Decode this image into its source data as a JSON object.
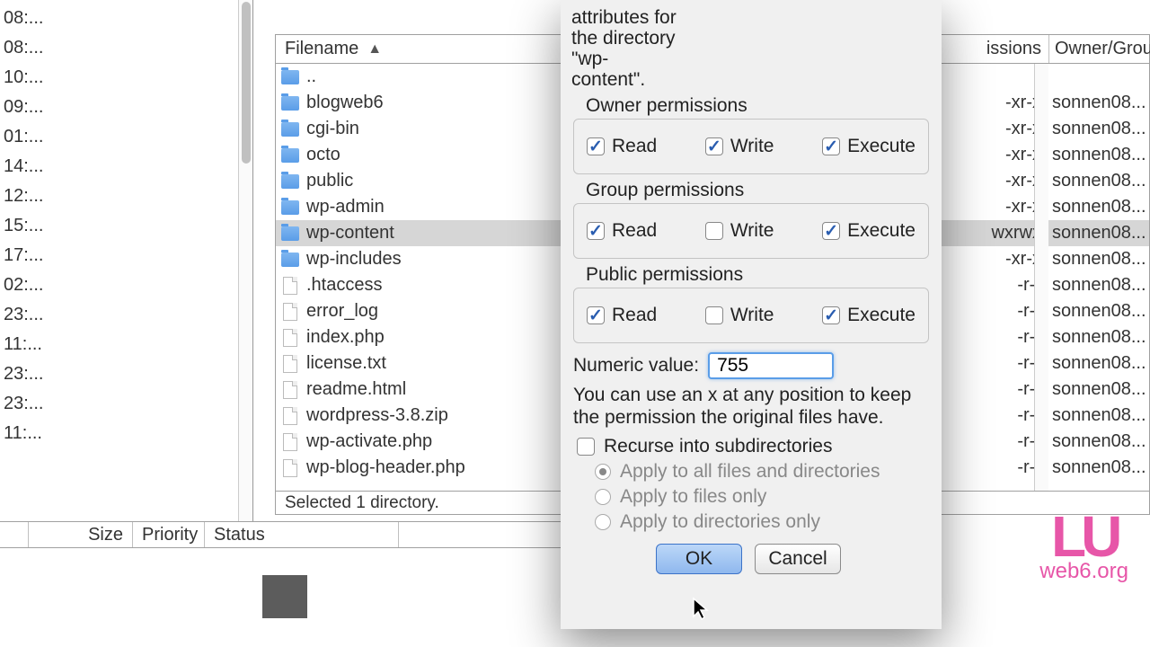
{
  "left_rows": [
    "08:...",
    "08:...",
    "10:...",
    "09:...",
    "01:...",
    "14:...",
    "12:...",
    "15:...",
    "17:...",
    "02:...",
    "23:...",
    "11:...",
    "23:...",
    "23:...",
    "11:..."
  ],
  "right_header": {
    "filename": "Filename",
    "permissions": "issions",
    "owner": "Owner/Group"
  },
  "files": [
    {
      "name": "..",
      "type": "folder",
      "perm": "",
      "owner": ""
    },
    {
      "name": "blogweb6",
      "type": "folder",
      "perm": "-xr-x",
      "owner": "sonnen08..."
    },
    {
      "name": "cgi-bin",
      "type": "folder",
      "perm": "-xr-x",
      "owner": "sonnen08..."
    },
    {
      "name": "octo",
      "type": "folder",
      "perm": "-xr-x",
      "owner": "sonnen08..."
    },
    {
      "name": "public",
      "type": "folder",
      "perm": "-xr-x",
      "owner": "sonnen08..."
    },
    {
      "name": "wp-admin",
      "type": "folder",
      "perm": "-xr-x",
      "owner": "sonnen08..."
    },
    {
      "name": "wp-content",
      "type": "folder",
      "perm": "wxrwx",
      "owner": "sonnen08...",
      "selected": true
    },
    {
      "name": "wp-includes",
      "type": "folder",
      "perm": "-xr-x",
      "owner": "sonnen08..."
    },
    {
      "name": ".htaccess",
      "type": "file",
      "perm": "-r--",
      "owner": "sonnen08..."
    },
    {
      "name": "error_log",
      "type": "file",
      "perm": "-r--",
      "owner": "sonnen08..."
    },
    {
      "name": "index.php",
      "type": "file",
      "perm": "-r--",
      "owner": "sonnen08..."
    },
    {
      "name": "license.txt",
      "type": "file",
      "perm": "-r--",
      "owner": "sonnen08..."
    },
    {
      "name": "readme.html",
      "type": "file",
      "perm": "-r--",
      "owner": "sonnen08..."
    },
    {
      "name": "wordpress-3.8.zip",
      "type": "file",
      "perm": "-r--",
      "owner": "sonnen08..."
    },
    {
      "name": "wp-activate.php",
      "type": "file",
      "perm": "-r--",
      "owner": "sonnen08..."
    },
    {
      "name": "wp-blog-header.php",
      "type": "file",
      "perm": "-r--",
      "owner": "sonnen08..."
    }
  ],
  "status_bar": "Selected 1 directory.",
  "transfer": {
    "size": "Size",
    "priority": "Priority",
    "status": "Status"
  },
  "dialog": {
    "top_text": "attributes for the directory \"wp-content\".",
    "owner_title": "Owner permissions",
    "group_title": "Group permissions",
    "public_title": "Public permissions",
    "read": "Read",
    "write": "Write",
    "execute": "Execute",
    "numeric_label": "Numeric value:",
    "numeric_value": "755",
    "hint": "You can use an x at any position to keep the permission the original files have.",
    "recurse": "Recurse into subdirectories",
    "apply_all": "Apply to all files and directories",
    "apply_files": "Apply to files only",
    "apply_dirs": "Apply to directories only",
    "ok": "OK",
    "cancel": "Cancel"
  },
  "watermark": {
    "glyph": "LU",
    "link": "web6.org"
  }
}
